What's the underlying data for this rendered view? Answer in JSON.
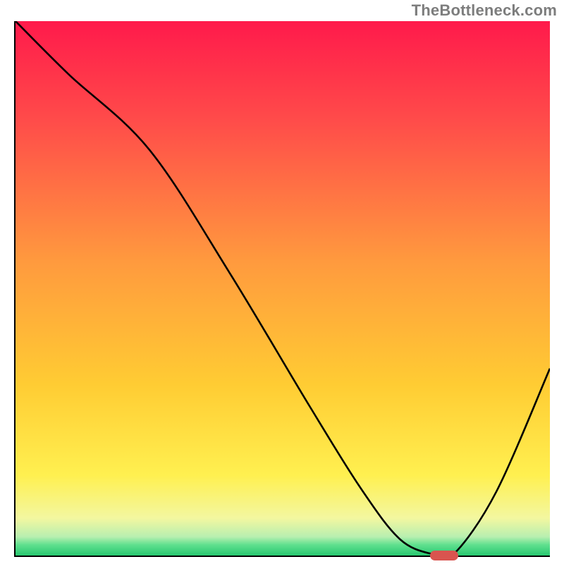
{
  "watermark": "TheBottleneck.com",
  "chart_data": {
    "type": "line",
    "title": "",
    "xlabel": "",
    "ylabel": "",
    "xlim": [
      0,
      100
    ],
    "ylim": [
      0,
      100
    ],
    "x": [
      0,
      10,
      25,
      40,
      55,
      65,
      72,
      78,
      82,
      90,
      100
    ],
    "y": [
      100,
      90,
      76,
      53,
      28,
      12,
      3,
      0,
      0,
      12,
      35
    ],
    "optimum_x": 80,
    "gradient_stops": [
      {
        "pos": 0,
        "color": "#ff1a4b"
      },
      {
        "pos": 0.45,
        "color": "#ff9a3e"
      },
      {
        "pos": 0.85,
        "color": "#fff050"
      },
      {
        "pos": 1.0,
        "color": "#28c770"
      }
    ],
    "marker": {
      "x": 80,
      "color": "#d9544f"
    }
  }
}
